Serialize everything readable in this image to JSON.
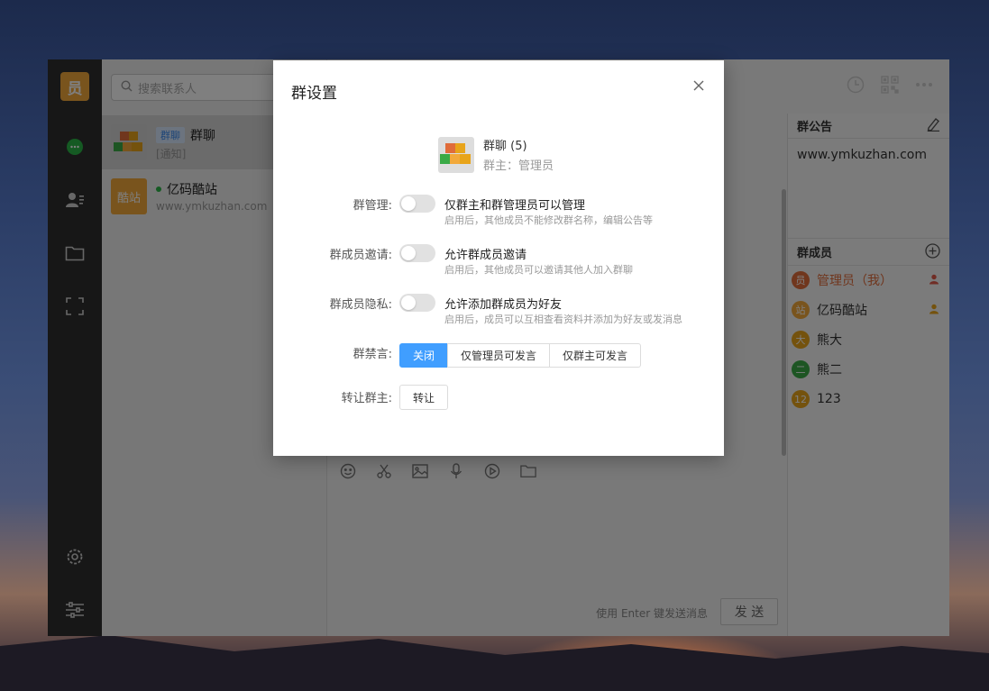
{
  "sidebar": {
    "me_avatar_char": "员"
  },
  "contacts": {
    "search_placeholder": "搜索联系人",
    "items": [
      {
        "tag": "群聊",
        "name": "群聊",
        "sub": "[通知]"
      },
      {
        "avatar_text": "酷站",
        "name": "亿码酷站",
        "sub": "www.ymkuzhan.com"
      }
    ]
  },
  "chat": {
    "enter_hint": "使用 Enter 键发送消息",
    "send_label": "发 送"
  },
  "right_panel": {
    "announce_title": "群公告",
    "announce_text": "www.ymkuzhan.com",
    "members_title": "群成员",
    "members": [
      {
        "avatar": "员",
        "name": "管理员（我）",
        "color": "#e06c3a"
      },
      {
        "avatar": "站",
        "name": "亿码酷站",
        "color": "#f2a93b"
      },
      {
        "avatar": "大",
        "name": "熊大",
        "color": "#e8a41a"
      },
      {
        "avatar": "二",
        "name": "熊二",
        "color": "#3aaa46"
      },
      {
        "avatar": "12",
        "name": "123",
        "color": "#e8a41a"
      }
    ]
  },
  "dialog": {
    "title": "群设置",
    "group_name": "群聊 (5)",
    "group_owner": "群主：管理员",
    "group_avatar_cells": [
      "员",
      "大",
      "二",
      "站",
      "12"
    ],
    "rows": [
      {
        "label": "群管理:",
        "title": "仅群主和群管理员可以管理",
        "desc": "启用后，其他成员不能修改群名称，编辑公告等"
      },
      {
        "label": "群成员邀请:",
        "title": "允许群成员邀请",
        "desc": "启用后，其他成员可以邀请其他人加入群聊"
      },
      {
        "label": "群成员隐私:",
        "title": "允许添加群成员为好友",
        "desc": "启用后，成员可以互相查看资料并添加为好友或发消息"
      }
    ],
    "mute_label": "群禁言:",
    "mute_options": [
      "关闭",
      "仅管理员可发言",
      "仅群主可发言"
    ],
    "mute_selected": "关闭",
    "transfer_label": "转让群主:",
    "transfer_button": "转让"
  },
  "colors": {
    "accent": "#409eff",
    "nav_bg": "#2e2e2e",
    "chat_icon": "#2ab447"
  }
}
